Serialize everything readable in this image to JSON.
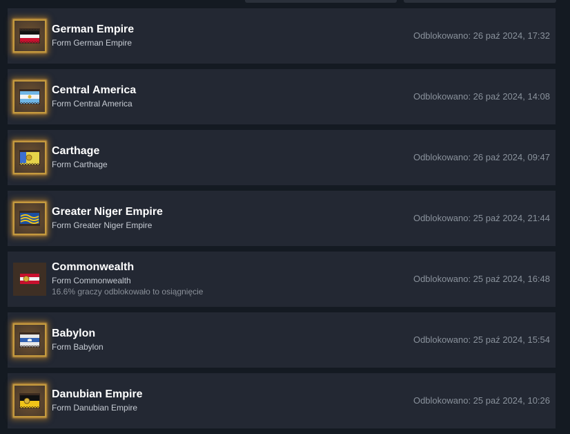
{
  "achievements": [
    {
      "title": "German Empire",
      "description": "Form German Empire",
      "unlocked": "Odblokowano: 26 paź 2024, 17:32",
      "icon": "german-empire-flag-icon"
    },
    {
      "title": "Central America",
      "description": "Form Central America",
      "unlocked": "Odblokowano: 26 paź 2024, 14:08",
      "icon": "central-america-flag-icon"
    },
    {
      "title": "Carthage",
      "description": "Form Carthage",
      "unlocked": "Odblokowano: 26 paź 2024, 09:47",
      "icon": "carthage-flag-icon"
    },
    {
      "title": "Greater Niger Empire",
      "description": "Form Greater Niger Empire",
      "unlocked": "Odblokowano: 25 paź 2024, 21:44",
      "icon": "greater-niger-empire-flag-icon"
    },
    {
      "title": "Commonwealth",
      "description": "Form Commonwealth",
      "rarity": "16.6% graczy odblokowało to osiągnięcie",
      "unlocked": "Odblokowano: 25 paź 2024, 16:48",
      "icon": "commonwealth-flag-icon"
    },
    {
      "title": "Babylon",
      "description": "Form Babylon",
      "unlocked": "Odblokowano: 25 paź 2024, 15:54",
      "icon": "babylon-flag-icon"
    },
    {
      "title": "Danubian Empire",
      "description": "Form Danubian Empire",
      "unlocked": "Odblokowano: 25 paź 2024, 10:26",
      "icon": "danubian-empire-flag-icon"
    }
  ],
  "colors": {
    "background": "#141a22",
    "row": "#232833",
    "title": "#ffffff",
    "badge_border": "#c49a3e",
    "badge_glow": "#dc9628"
  }
}
